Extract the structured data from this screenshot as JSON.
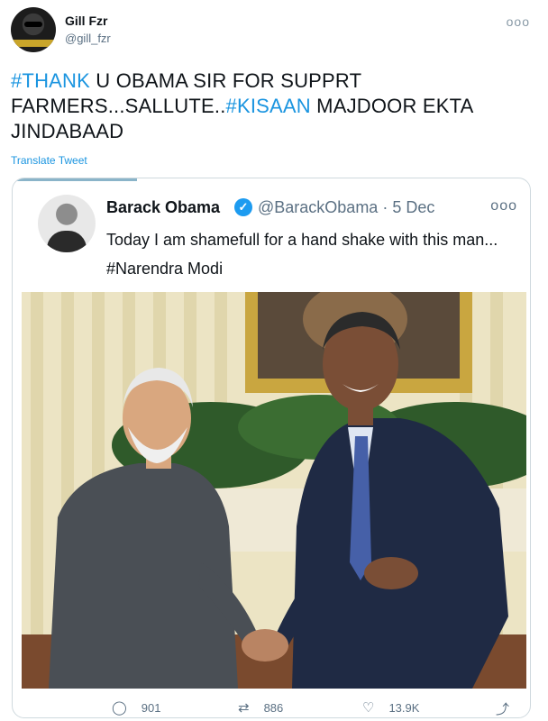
{
  "user": {
    "name": "Gill Fzr",
    "handle": "@gill_fzr"
  },
  "tweet": {
    "hashtag1": "#THANK",
    "text1": " U OBAMA SIR FOR SUPPRT FARMERS...SALLUTE..",
    "hashtag2": "#KISAAN",
    "text2": " MAJDOOR EKTA JINDABAAD"
  },
  "translate_label": "Translate Tweet",
  "quoted": {
    "name": "Barack Obama",
    "handle_date": "@BarackObama · 5 Dec",
    "text": "Today I am shamefull for a hand shake with this man... #Narendra Modi"
  },
  "stats": {
    "replies": "901",
    "retweets": "886",
    "likes": "13.9K"
  },
  "icons": {
    "more": "more-icon",
    "verified": "verified-badge-icon",
    "reply": "reply-icon",
    "retweet": "retweet-icon",
    "like": "heart-icon",
    "share": "share-icon"
  },
  "colors": {
    "link": "#1b95e0",
    "secondary_text": "#5b7083",
    "verified": "#1d9bf0"
  }
}
